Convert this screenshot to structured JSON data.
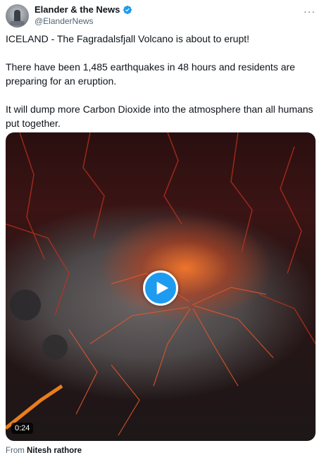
{
  "author": {
    "display_name": "Elander & the News",
    "handle": "@ElanderNews",
    "verified": true,
    "verified_color": "#1d9bf0",
    "avatar_icon": "avatar-image"
  },
  "more_menu_icon": "ellipsis-icon",
  "tweet": {
    "paragraphs": [
      "ICELAND - The Fagradalsfjall Volcano is about to erupt!",
      "There have been 1,485 earthquakes in 48 hours and residents are preparing for an eruption.",
      "It will dump more Carbon Dioxide into the atmosphere than all humans put together."
    ]
  },
  "media": {
    "type": "video",
    "duration": "0:24",
    "play_icon": "play-icon",
    "accent_color": "#1d9bf0"
  },
  "attribution": {
    "prefix": "From",
    "source": "Nitesh rathore"
  }
}
